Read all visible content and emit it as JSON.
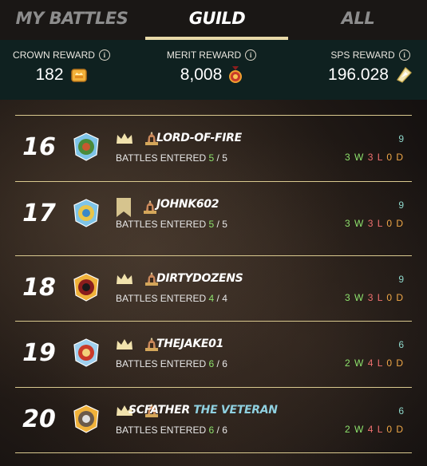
{
  "tabs": [
    {
      "label": "MY BATTLES",
      "active": false
    },
    {
      "label": "GUILD",
      "active": true
    },
    {
      "label": "ALL",
      "active": false
    }
  ],
  "rewards": {
    "crown": {
      "label": "CROWN REWARD",
      "value": "182",
      "icon": "crown-chest-icon"
    },
    "merit": {
      "label": "MERIT REWARD",
      "value": "8,008",
      "icon": "merit-medal-icon"
    },
    "sps": {
      "label": "SPS REWARD",
      "value": "196.028",
      "icon": "sps-token-icon"
    }
  },
  "colors": {
    "accent": "#e8d9a8",
    "win": "#8ee36d",
    "loss": "#f07070",
    "draw": "#f0a848",
    "points": "#8fd8cb",
    "rewards_bg": "#0f2120"
  },
  "battles_label": "BATTLES ENTERED",
  "rows": [
    {
      "rank": "16",
      "name": "LORD-OF-FIRE",
      "title": "",
      "entered": "5",
      "total": "5",
      "points": "9",
      "w": "3 W",
      "l": "3 L",
      "d": "0 D",
      "banner": "crown"
    },
    {
      "rank": "17",
      "name": "JOHNK602",
      "title": "",
      "entered": "5",
      "total": "5",
      "points": "9",
      "w": "3 W",
      "l": "3 L",
      "d": "0 D",
      "banner": "flag"
    },
    {
      "rank": "18",
      "name": "DIRTYDOZENS",
      "title": "",
      "entered": "4",
      "total": "4",
      "points": "9",
      "w": "3 W",
      "l": "3 L",
      "d": "0 D",
      "banner": "crown"
    },
    {
      "rank": "19",
      "name": "THEJAKE01",
      "title": "",
      "entered": "6",
      "total": "6",
      "points": "6",
      "w": "2 W",
      "l": "4 L",
      "d": "0 D",
      "banner": "crown"
    },
    {
      "rank": "20",
      "name": "SCFATHER",
      "title": "THE VETERAN",
      "entered": "6",
      "total": "6",
      "points": "6",
      "w": "2 W",
      "l": "4 L",
      "d": "0 D",
      "banner": "crown"
    }
  ]
}
